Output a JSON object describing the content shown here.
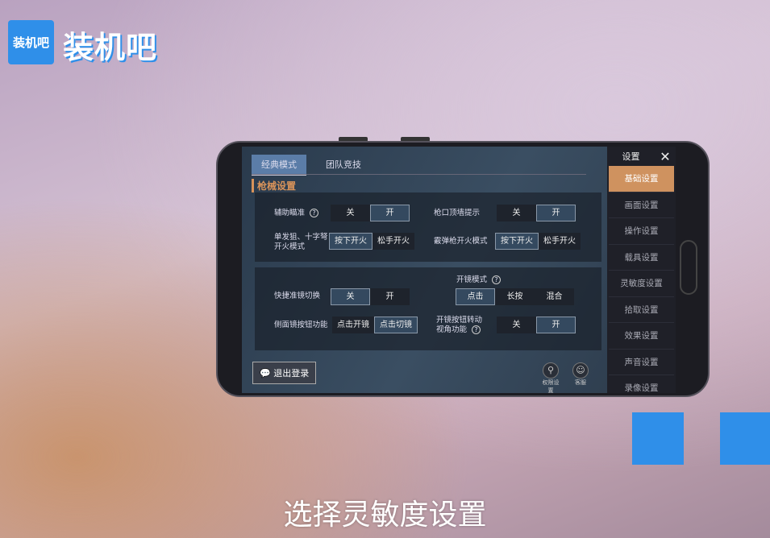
{
  "branding": {
    "logo_text": "装机吧",
    "brand_text": "装机吧",
    "accent": "#2f8fe9"
  },
  "game": {
    "tabs": [
      {
        "label": "经典模式",
        "active": true
      },
      {
        "label": "团队竞技",
        "active": false
      }
    ],
    "section": "枪械设置",
    "rows1": [
      {
        "label": "辅助瞄准",
        "help": true,
        "options": [
          "关",
          "开"
        ],
        "selected": 1
      },
      {
        "label": "枪口顶墙提示",
        "options": [
          "关",
          "开"
        ],
        "selected": 1
      },
      {
        "label": "单发狙、十字弩开火模式",
        "options": [
          "按下开火",
          "松手开火"
        ],
        "selected": 0
      },
      {
        "label": "霰弹枪开火模式",
        "options": [
          "按下开火",
          "松手开火"
        ],
        "selected": 0
      }
    ],
    "rows2": [
      {
        "label": "快捷准镜切换",
        "options": [
          "关",
          "开"
        ],
        "selected": 0
      },
      {
        "label": "开镜模式",
        "help": true,
        "options": [
          "点击",
          "长按",
          "混合"
        ],
        "selected": 0
      },
      {
        "label": "侧面镜按钮功能",
        "options": [
          "点击开镜",
          "点击切镜"
        ],
        "selected": 1
      },
      {
        "label": "开镜按钮转动视角功能",
        "help": true,
        "options": [
          "关",
          "开"
        ],
        "selected": 1
      }
    ],
    "logout": "退出登录",
    "bottom_icons": [
      {
        "name": "shield-icon",
        "label": "权限设置"
      },
      {
        "name": "support-icon",
        "label": "客服"
      }
    ],
    "sidebar": {
      "title": "设置",
      "close": "✕",
      "items": [
        "基础设置",
        "画面设置",
        "操作设置",
        "载具设置",
        "灵敏度设置",
        "拾取设置",
        "效果设置",
        "声音设置",
        "录像设置"
      ],
      "active": 0,
      "accent": "#cf925f"
    }
  },
  "caption": "选择灵敏度设置"
}
